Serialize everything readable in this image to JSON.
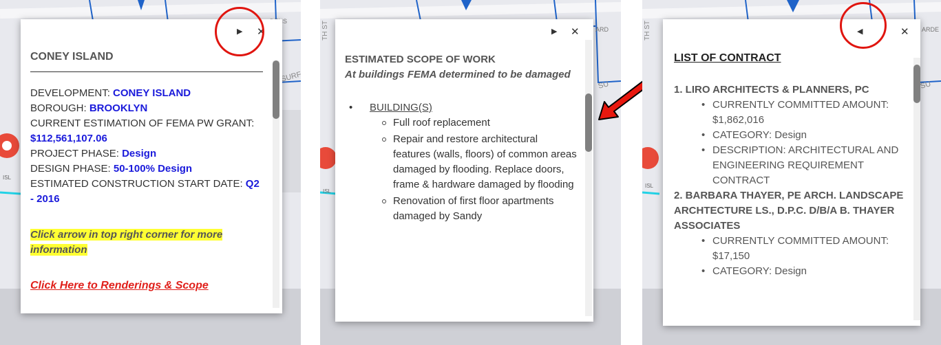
{
  "panel1": {
    "controls": {
      "next_arrow": "▶",
      "close": "✕"
    },
    "title": "CONEY ISLAND",
    "fields": [
      {
        "label": "DEVELOPMENT: ",
        "value": "CONEY ISLAND"
      },
      {
        "label": "BOROUGH: ",
        "value": "BROOKLYN"
      },
      {
        "label": "CURRENT ESTIMATION OF FEMA PW GRANT: ",
        "value": "$112,561,107.06"
      },
      {
        "label": "PROJECT PHASE: ",
        "value": "Design"
      },
      {
        "label": "DESIGN PHASE: ",
        "value": "50-100% Design"
      },
      {
        "label": "ESTIMATED CONSTRUCTION START DATE: ",
        "value": " Q2 - 2016"
      }
    ],
    "note": "Click arrow in top right corner for more information",
    "link": "Click Here to Renderings & Scope "
  },
  "panel2": {
    "controls": {
      "next_arrow": "▶",
      "close": "✕"
    },
    "heading": "ESTIMATED SCOPE OF WORK",
    "subheading": "At buildings FEMA determined to be damaged",
    "section": "BUILDING(S)",
    "items": [
      "Full roof replacement",
      "Repair and restore architectural features (walls, floors) of common areas damaged by flooding. Replace doors, frame & hardware damaged by flooding",
      "Renovation of first floor apartments damaged by Sandy"
    ]
  },
  "panel3": {
    "controls": {
      "prev_arrow": "◀",
      "close": "✕"
    },
    "title": "LIST OF CONTRACT",
    "contracts": [
      {
        "name": "1. LIRO ARCHITECTS & PLANNERS, PC",
        "details": [
          "CURRENTLY COMMITTED AMOUNT: $1,862,016",
          "CATEGORY: Design",
          "DESCRIPTION: ARCHITECTURAL AND ENGINEERING REQUIREMENT CONTRACT"
        ]
      },
      {
        "name": "2. BARBARA THAYER, PE ARCH. LANDSCAPE ARCHTECTURE LS., D.P.C. D/B/A B. THAYER ASSOCIATES",
        "details": [
          "CURRENTLY COMMITTED AMOUNT: $17,150",
          "CATEGORY: Design"
        ]
      }
    ]
  },
  "map_labels": {
    "gardens_1": "DENS",
    "surf_1": "SURF",
    "ardens_2": "ARD",
    "surf_2": "SU",
    "th_st_2": "TH ST",
    "isl_1": "ISL",
    "isl_2": "ISL",
    "gardens_3": "ARDE",
    "surf_3": "SU",
    "th_st_3": "TH ST",
    "isl_3": "ISL"
  },
  "colors": {
    "accent_blue": "#1a1adb",
    "link_red": "#e0201b",
    "highlight_yellow": "#ffff33",
    "annotation_red": "#e0150f"
  }
}
